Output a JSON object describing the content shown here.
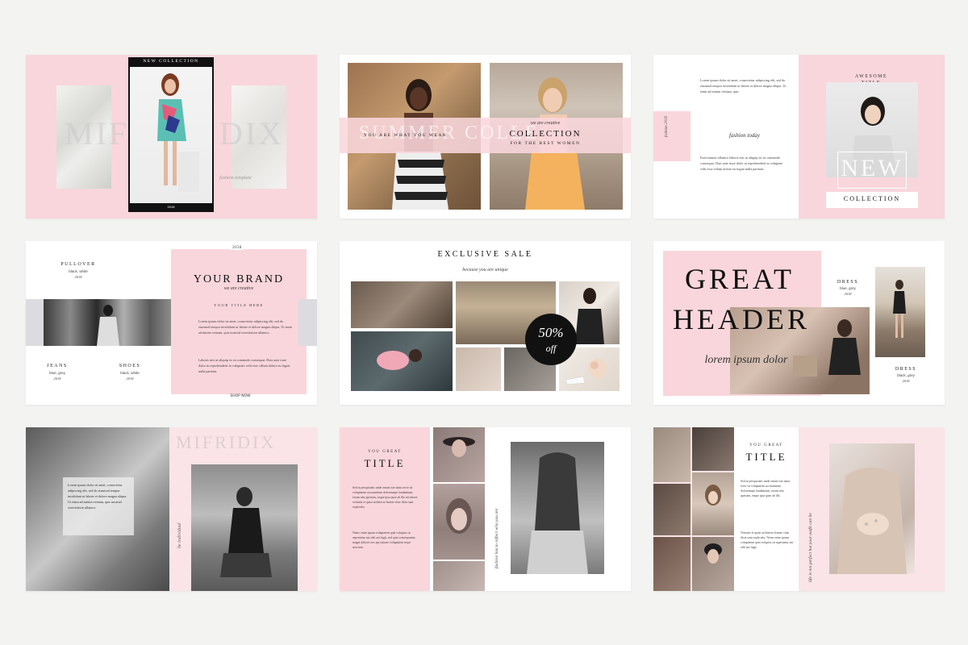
{
  "colors": {
    "pink": "#f9d6dc",
    "pink_light": "#fbe4e7",
    "background": "#f3f3f1",
    "black": "#111111"
  },
  "slides": {
    "s1": {
      "banner": "NEW COLLECTION",
      "ghost_left": "MIF",
      "ghost_right": "DIX",
      "script": "fashion template",
      "year": "2018"
    },
    "s2": {
      "script": "we are creative",
      "left_text": "YOU ARE WHAT YOU WEAR",
      "ghost": "SUMMER COLLE",
      "title": "COLLECTION",
      "subtitle": "FOR THE BEST WOMEN"
    },
    "s3": {
      "body1": "Lorem ipsum dolor sit amet, consectetur adipiscing elit, sed do eiusmod tempor incididunt ut labore et dolore magna aliqua. Ut enim ad minim veniam, quis",
      "script": "fashion today",
      "body2": "Exercitation ullamco laboris nisi ut aliquip ex ea commodo consequat. Duis aute irure dolor in reprehenderit in voluptate velit esse cillum dolore eu fugiat nulla pariatur.",
      "side_script": "fashion 2018",
      "pre_title": "AWESOME",
      "pre_title2": "TITLE",
      "big": "NEW",
      "collection": "COLLECTION"
    },
    "s4": {
      "year": "2018",
      "pullover": "PULLOVER",
      "pullover_sub": "black, white",
      "pullover_year": "2018",
      "brand": "YOUR BRAND",
      "brand_script": "we are creative",
      "your_title": "YOUR TITLE HERE",
      "body1": "Lorem ipsum dolor sit amet, consectetur adipiscing elit, sed do eiusmod tempor incididunt ut labore et dolore magna aliqua. Ut enim ad minim veniam, quis nostrud exercitation ullamco.",
      "body2": "Laboris nisi ut aliquip ex ea commodo consequat. Duis aute irure dolor in reprehenderit in voluptate velit esse cillum dolore eu fugiat nulla pariatur.",
      "jeans": "JEANS",
      "jeans_sub": "blue, grey",
      "jeans_year": "2018",
      "shoes": "SHOES",
      "shoes_sub": "black, white",
      "shoes_year": "2018",
      "shop": "SHOP NOW"
    },
    "s5": {
      "title": "EXCLUSIVE SALE",
      "script": "because you are unique",
      "badge_pct": "50%",
      "badge_off": "off"
    },
    "s6": {
      "great": "GREAT",
      "header": "HEADER",
      "script": "lorem ipsum dolor",
      "dress1": "DRESS",
      "dress1_sub": "blue, grey",
      "dress1_year": "2018",
      "dress2": "DRESS",
      "dress2_sub": "black, grey",
      "dress2_year": "2018"
    },
    "s7": {
      "ghost": "MIFRIDIX",
      "body": "Lorem ipsum dolor sit amet, consectetur adipiscing elit, sed do eiusmod tempor incididunt ut labore et dolore magna aliqua. Ut enim ad minim veniam, quis nostrud exercitation ullamco.",
      "side_script": "be individual"
    },
    "s8": {
      "pre": "YOU GREAT",
      "title": "TITLE",
      "body1": "Sed ut perspiciatis unde omnis iste natus error sit voluptatem accusantium doloremque laudantium, totam rem aperiam, eaque ipsa quae ab illo inventore veritatis et quasi architecto beatae vitae dicta sunt explicabo.",
      "body2": "Nemo enim ipsam voluptatem quia voluptas sit aspernatur aut odit aut fugit, sed quia consequuntur magni dolores eos qui ratione voluptatem sequi nesciunt.",
      "side_script": "fashion has to reflect who you are"
    },
    "s9": {
      "pre": "YOU GREAT",
      "title": "TITLE",
      "body1": "Sed ut perspiciatis unde omnis iste natus error sit voluptatem accusantium doloremque laudantium, totam rem aperiam, eaque ipsa quae ab illo.",
      "body2": "Veritatis et quasi architecto beatae vitae dicta sunt explicabo. Nemo enim ipsam voluptatem quia voluptas sit aspernatur aut odit aut fugit.",
      "side_script": "life is not perfect but your outfit can be"
    }
  }
}
